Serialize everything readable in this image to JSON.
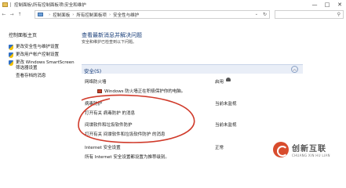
{
  "window": {
    "title": "控制面板\\所有控制面板项\\安全和维护",
    "controls": [
      "—",
      "□",
      "✕"
    ]
  },
  "address": {
    "nav": [
      "←",
      "→",
      "↑"
    ],
    "breadcrumbs": [
      "控制面板",
      "所有控制面板项",
      "安全性与维护"
    ],
    "separator": "›",
    "dropdown": "⌄",
    "refresh": "↻",
    "search_icon": "search-icon"
  },
  "sidebar": {
    "home": "控制面板主页",
    "items": [
      {
        "label": "更改安全性与维护设置",
        "icon": "shield-icon"
      },
      {
        "label": "更改用户帐户控制设置",
        "icon": "shield-icon"
      },
      {
        "label": "更改 Windows SmartScreen 筛选器设置",
        "icon": "shield-icon"
      },
      {
        "label": "查看存档的消息",
        "icon": ""
      }
    ]
  },
  "main": {
    "heading": "查看最新消息并解决问题",
    "subtitle": "安全和维护已检查到以下问题。"
  },
  "security_section": {
    "label": "安全(S)",
    "collapse": "︿",
    "rows": [
      {
        "title": "网络防火墙",
        "status": "启用",
        "desc": "Windows 防火墙正在积极保护你的电脑。",
        "link": ""
      },
      {
        "title": "病毒防护",
        "status": "当前未监视",
        "desc": "",
        "link": "打开有关 病毒防护 的消息"
      },
      {
        "title": "间谍软件和垃圾软件防护",
        "status": "当前未监视",
        "desc": "",
        "link": "打开有关 间谍软件和垃圾软件防护 的消息"
      },
      {
        "title": "Internet 安全设置",
        "status": "正常",
        "desc": "所有 Internet 安全设置都设置为推荐级别。",
        "link": ""
      }
    ]
  },
  "annotation": {
    "color": "#d03a2a"
  },
  "watermark": {
    "name_cn": "创新互联",
    "name_en": "CHUANG XIN HU LIAN",
    "color": "#d84c2d"
  }
}
